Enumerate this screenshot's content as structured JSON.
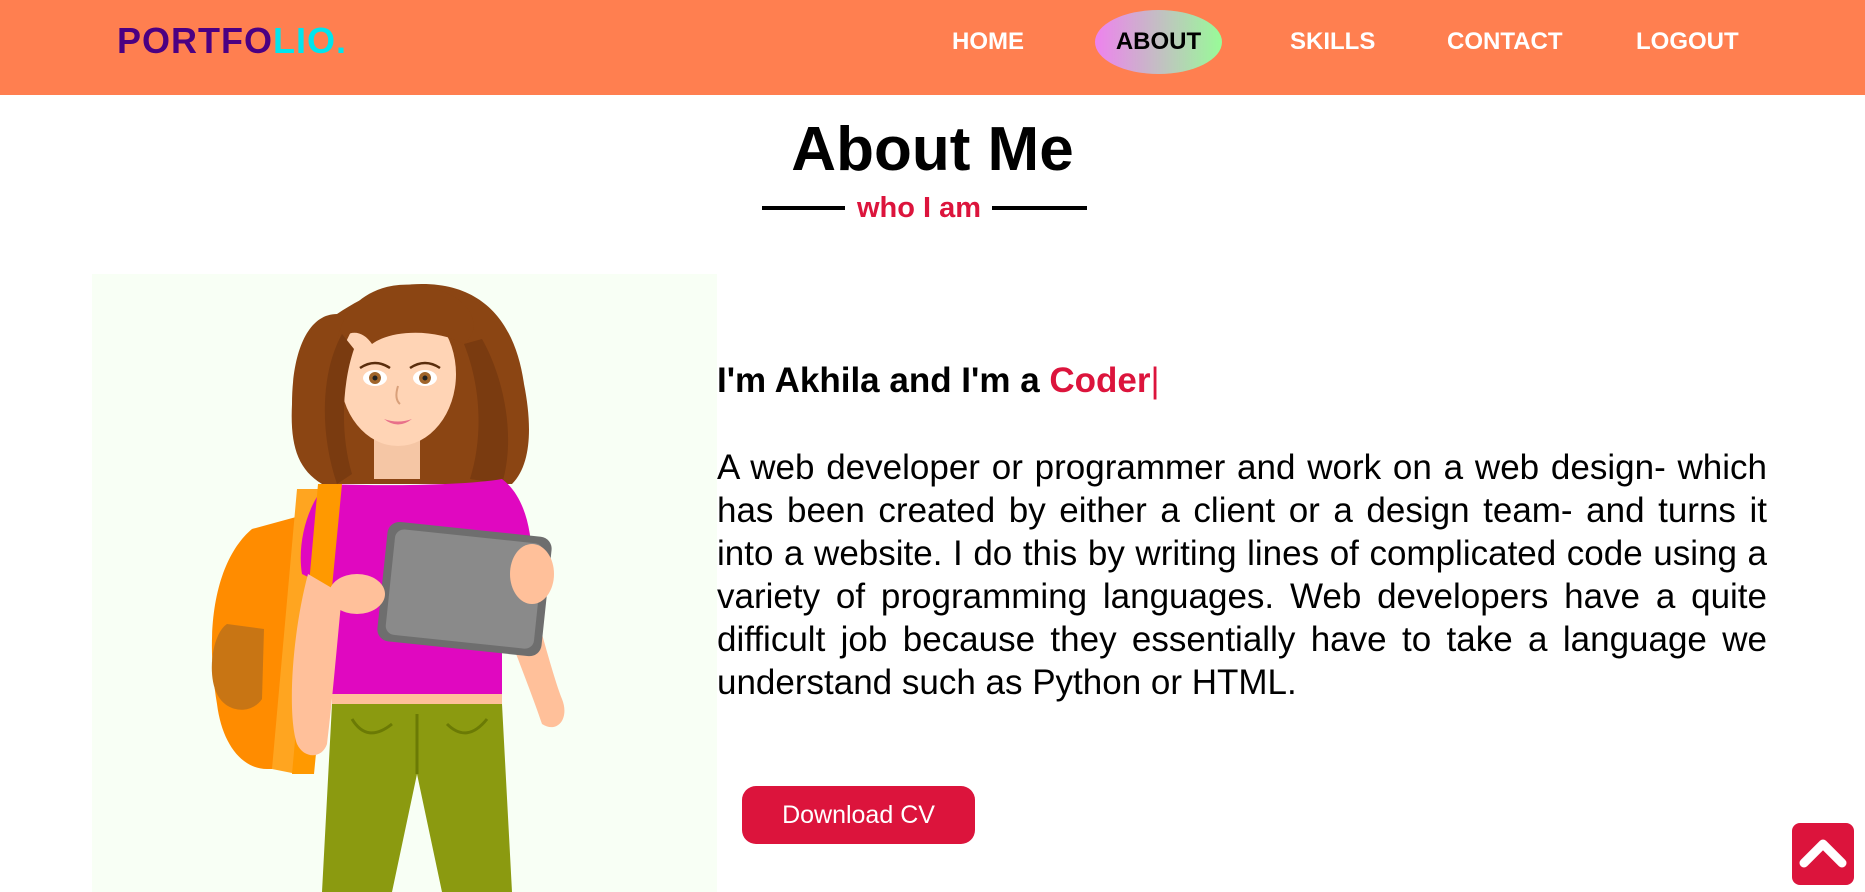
{
  "nav": {
    "logo_part1": "PORTFO",
    "logo_part2": "LIO.",
    "items": [
      {
        "label": "HOME"
      },
      {
        "label": "ABOUT"
      },
      {
        "label": "SKILLS"
      },
      {
        "label": "CONTACT"
      },
      {
        "label": "LOGOUT"
      }
    ],
    "active": "ABOUT"
  },
  "about": {
    "title": "About Me",
    "subtitle": "who I am",
    "intro_prefix": "I'm Akhila and I'm a ",
    "intro_role": "Coder",
    "intro_cursor": "|",
    "bio": "A web developer or programmer and work on a web design- which has been created by either a client or a design team- and turns it into a website. I do this by writing lines of complicated code using a variety of programming languages. Web developers have a quite difficult job because they essentially have to take a language we understand such as Python or HTML.",
    "cv_button": "Download CV"
  },
  "icons": {
    "scroll_top": "chevron-up-icon",
    "illustration": "girl-with-tablet-illustration"
  },
  "colors": {
    "navbar": "#ff7f50",
    "accent": "#dc143c",
    "logo_dark": "#4b0082",
    "logo_light": "#00e5ee",
    "active_gradient_start": "#ee82ee",
    "active_gradient_end": "#98fb98"
  }
}
